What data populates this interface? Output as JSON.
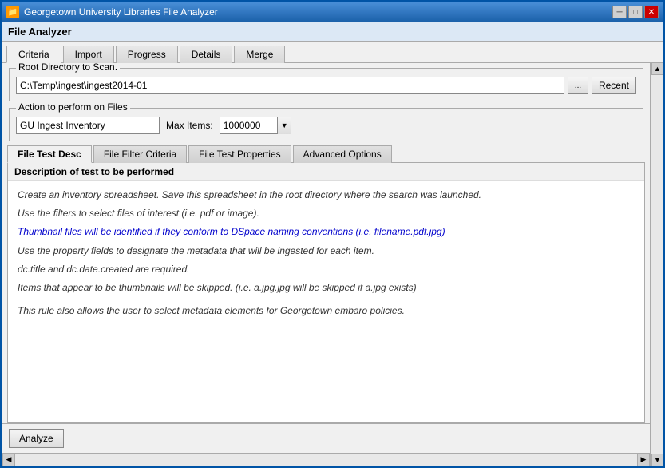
{
  "window": {
    "title": "Georgetown University Libraries File Analyzer",
    "icon": "📁"
  },
  "title_buttons": {
    "minimize": "─",
    "maximize": "□",
    "close": "✕"
  },
  "file_analyzer_label": "File Analyzer",
  "main_tabs": [
    {
      "id": "criteria",
      "label": "Criteria",
      "active": true
    },
    {
      "id": "import",
      "label": "Import",
      "active": false
    },
    {
      "id": "progress",
      "label": "Progress",
      "active": false
    },
    {
      "id": "details",
      "label": "Details",
      "active": false,
      "disabled": false
    },
    {
      "id": "merge",
      "label": "Merge",
      "active": false,
      "disabled": false
    }
  ],
  "root_directory": {
    "label": "Root Directory to Scan.",
    "value": "C:\\Temp\\ingest\\ingest2014-01",
    "browse_label": "...",
    "recent_label": "Recent"
  },
  "action": {
    "label": "Action to perform on Files",
    "dropdown_value": "GU Ingest Inventory",
    "options": [
      "GU Ingest Inventory"
    ],
    "max_items_label": "Max Items:",
    "max_items_value": "1000000"
  },
  "inner_tabs": [
    {
      "id": "file-test-desc",
      "label": "File Test Desc",
      "active": true
    },
    {
      "id": "file-filter-criteria",
      "label": "File Filter Criteria",
      "active": false
    },
    {
      "id": "file-test-properties",
      "label": "File Test Properties",
      "active": false
    },
    {
      "id": "advanced-options",
      "label": "Advanced Options",
      "active": false
    }
  ],
  "description": {
    "header": "Description of test to be performed",
    "lines": [
      {
        "text": "Create an inventory spreadsheet.  Save this spreadsheet in the root directory where the search was launched.",
        "style": "normal"
      },
      {
        "text": "Use the filters to select files of interest (i.e. pdf or image).",
        "style": "italic"
      },
      {
        "text": "Thumbnail files will be identified if they conform to DSpace naming conventions (i.e. filename.pdf.jpg)",
        "style": "blue"
      },
      {
        "text": "Use the property fields to designate the metadata that will be ingested for each item.",
        "style": "normal"
      },
      {
        "text": "dc.title and dc.date.created are required.",
        "style": "normal"
      },
      {
        "text": "Items that appear to be thumbnails will be skipped.  (i.e. a.jpg.jpg will be skipped if a.jpg exists)",
        "style": "normal"
      },
      {
        "text": "",
        "style": "normal"
      },
      {
        "text": "This rule also allows the user to select metadata elements for Georgetown embaro policies.",
        "style": "normal"
      }
    ]
  },
  "analyze_button": {
    "label": "Analyze"
  }
}
